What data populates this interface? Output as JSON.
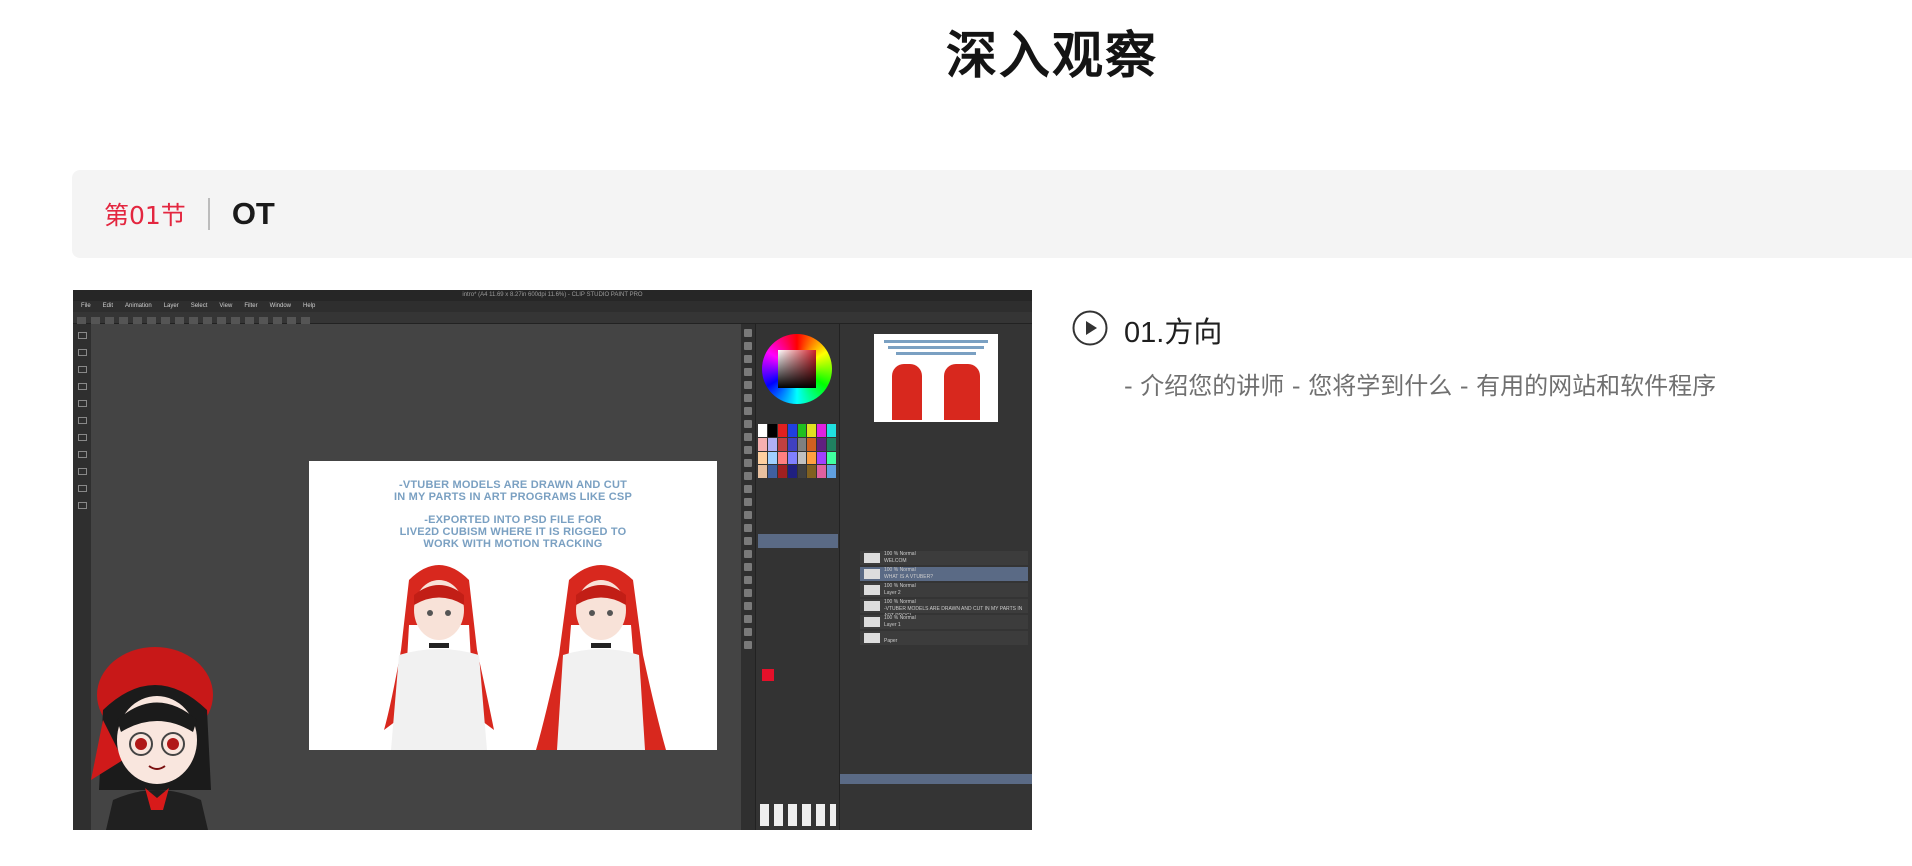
{
  "page": {
    "title": "深入观察"
  },
  "section": {
    "number_label": "第01节",
    "name": "OT"
  },
  "video": {
    "app_title": "intro* (A4 11.69 x 8.27in 600dpi 11.6%) - CLIP STUDIO PAINT PRO",
    "menu": [
      "File",
      "Edit",
      "Animation",
      "Layer",
      "Select",
      "View",
      "Filter",
      "Window",
      "Help"
    ],
    "doc_lines_1": [
      "-VTUBER MODELS ARE DRAWN AND CUT",
      "IN MY PARTS IN ART PROGRAMS LIKE CSP"
    ],
    "doc_lines_2": [
      "-EXPORTED INTO PSD FILE FOR",
      "LIVE2D CUBISM WHERE IT IS RIGGED TO",
      "WORK WITH MOTION TRACKING"
    ],
    "layers": [
      {
        "label": "100 % Normal",
        "name": "WELCOM"
      },
      {
        "label": "100 % Normal",
        "name": "WHAT IS A VTUBER?",
        "selected": true
      },
      {
        "label": "100 % Normal",
        "name": "Layer 2"
      },
      {
        "label": "100 % Normal",
        "name": "-VTUBER MODELS ARE DRAWN AND CUT IN MY PARTS IN ART PROGI"
      },
      {
        "label": "100 % Normal",
        "name": "Layer 1"
      },
      {
        "label": "",
        "name": "Paper"
      }
    ],
    "colors": {
      "hair": "#d8281e",
      "text_blue": "#7aa0c2",
      "canvas_bg": "#444444"
    }
  },
  "lesson": {
    "icon": "play-circle-icon",
    "title": "01.方向",
    "description": "- 介绍您的讲师 - 您将学到什么 - 有用的网站和软件程序"
  },
  "theme": {
    "accent": "#e3263f",
    "section_bg": "#f4f4f4"
  }
}
